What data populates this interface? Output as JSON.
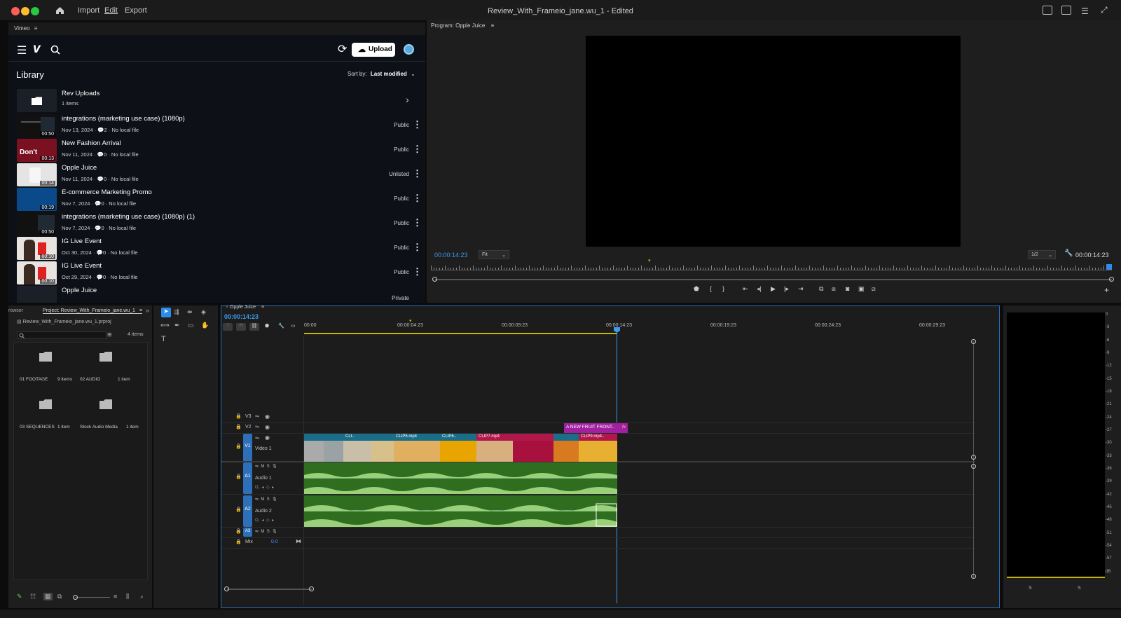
{
  "app": {
    "title": "Review_With_Frameio_jane.wu_1 - Edited",
    "menus": [
      "Import",
      "Edit",
      "Export"
    ]
  },
  "vimeo": {
    "tab": "Vimeo",
    "upload_label": "Upload",
    "library_title": "Library",
    "sort_prefix": "Sort by:",
    "sort_value": "Last modified",
    "folder": {
      "name": "Rev Uploads",
      "count": "1 items"
    },
    "videos": [
      {
        "title": "integrations (marketing use case) (1080p)",
        "meta": "Nov 13, 2024 · 💬2 · No local file",
        "privacy": "Public",
        "duration": "00:50"
      },
      {
        "title": "New Fashion Arrival",
        "meta": "Nov 11, 2024 · 💬0 · No local file",
        "privacy": "Public",
        "duration": "00:13"
      },
      {
        "title": "Opple Juice",
        "meta": "Nov 11, 2024 · 💬0 · No local file",
        "privacy": "Unlisted",
        "duration": "00:14"
      },
      {
        "title": "E-commerce Marketing Promo",
        "meta": "Nov 7, 2024 · 💬0 · No local file",
        "privacy": "Public",
        "duration": "00:19"
      },
      {
        "title": "integrations (marketing use case) (1080p) (1)",
        "meta": "Nov 7, 2024 · 💬0 · No local file",
        "privacy": "Public",
        "duration": "00:50"
      },
      {
        "title": "IG Live Event",
        "meta": "Oct 30, 2024 · 💬0 · No local file",
        "privacy": "Public",
        "duration": "00:10"
      },
      {
        "title": "IG Live Event",
        "meta": "Oct 29, 2024 · 💬0 · No local file",
        "privacy": "Public",
        "duration": "00:10"
      },
      {
        "title": "Opple Juice",
        "meta": "",
        "privacy": "Private",
        "duration": ""
      }
    ]
  },
  "program": {
    "tab": "Program: Opple Juice",
    "timecode": "00:00:14:23",
    "fit": "Fit",
    "resolution": "1/2",
    "duration": "00:00:14:23"
  },
  "project": {
    "tab_browser": "rowser",
    "tab_project": "Project: Review_With_Frameio_jane.wu_1",
    "file": "Review_With_Frameio_jane.wu_1.prproj",
    "item_count": "4 items",
    "bins": [
      {
        "name": "01 FOOTAGE",
        "count": "9 items"
      },
      {
        "name": "02 AUDIO",
        "count": "1 item"
      },
      {
        "name": "03 SEQUENCES",
        "count": "1 item"
      },
      {
        "name": "Stock Audio Media",
        "count": "1 item"
      }
    ]
  },
  "timeline": {
    "tab": "Opple Juice",
    "timecode": "00:00:14:23",
    "ruler": [
      "00:00",
      "00:00:04:23",
      "00:00:09:23",
      "00:00:14:23",
      "00:00:19:23",
      "00:00:24:23",
      "00:00:29:23"
    ],
    "tracks": {
      "v3": "V3",
      "v2": "V2",
      "v1": "V1",
      "video1": "Video 1",
      "a1": "A1",
      "audio1": "Audio 1",
      "a2": "A2",
      "audio2": "Audio 2",
      "a3": "A3",
      "mix": "Mix",
      "mix_value": "0.0"
    },
    "title_clip": "A NEW FRUIT FRONT..",
    "clips": [
      "CLI..",
      "CLIP5.mp4",
      "CLIP6..",
      "CLIP7.mp4",
      "CLIP9.mp4.."
    ]
  },
  "meters": {
    "scale": [
      "0",
      "-3",
      "-6",
      "-9",
      "-12",
      "-15",
      "-18",
      "-21",
      "-24",
      "-27",
      "-30",
      "-33",
      "-36",
      "-39",
      "-42",
      "-45",
      "-48",
      "-51",
      "-54",
      "-57",
      "dB"
    ],
    "s_labels": [
      "S",
      "S"
    ]
  },
  "colors": {
    "accent": "#2d8ceb",
    "clip_blue": "#1a6e8a",
    "clip_pink": "#b0184c",
    "title_purple": "#a020a0",
    "audio_green": "#2f6e1f"
  }
}
